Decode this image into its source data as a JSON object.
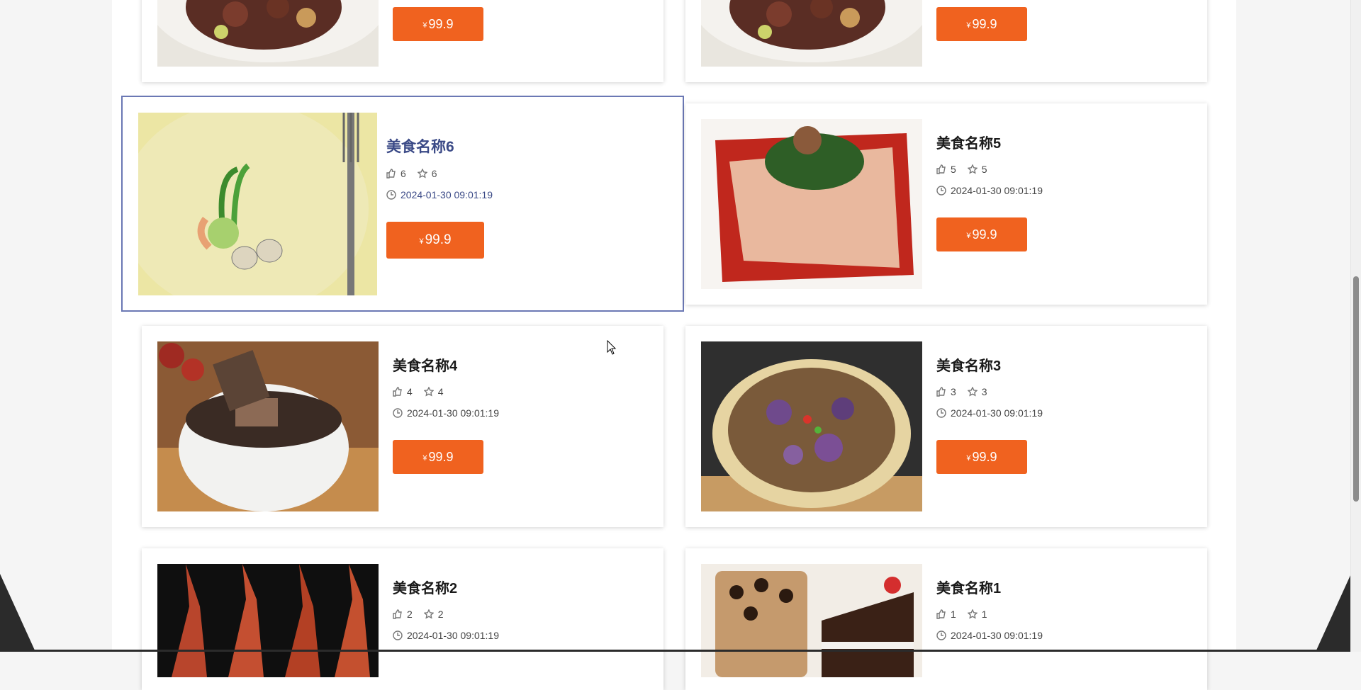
{
  "currency_symbol": "¥",
  "cards": [
    {
      "name": "",
      "likes": "",
      "favorites": "",
      "time": "",
      "price": "99.9"
    },
    {
      "name": "",
      "likes": "",
      "favorites": "",
      "time": "",
      "price": "99.9"
    },
    {
      "name": "美食名称6",
      "likes": "6",
      "favorites": "6",
      "time": "2024-01-30 09:01:19",
      "price": "99.9"
    },
    {
      "name": "美食名称5",
      "likes": "5",
      "favorites": "5",
      "time": "2024-01-30 09:01:19",
      "price": "99.9"
    },
    {
      "name": "美食名称4",
      "likes": "4",
      "favorites": "4",
      "time": "2024-01-30 09:01:19",
      "price": "99.9"
    },
    {
      "name": "美食名称3",
      "likes": "3",
      "favorites": "3",
      "time": "2024-01-30 09:01:19",
      "price": "99.9"
    },
    {
      "name": "美食名称2",
      "likes": "2",
      "favorites": "2",
      "time": "2024-01-30 09:01:19",
      "price": ""
    },
    {
      "name": "美食名称1",
      "likes": "1",
      "favorites": "1",
      "time": "2024-01-30 09:01:19",
      "price": ""
    }
  ],
  "icons": {
    "like": "thumbs-up-icon",
    "favorite": "star-icon",
    "time": "clock-icon"
  },
  "colors": {
    "price_button": "#f0621f",
    "active_border": "#6b78b4",
    "active_title": "#3b4a87"
  }
}
